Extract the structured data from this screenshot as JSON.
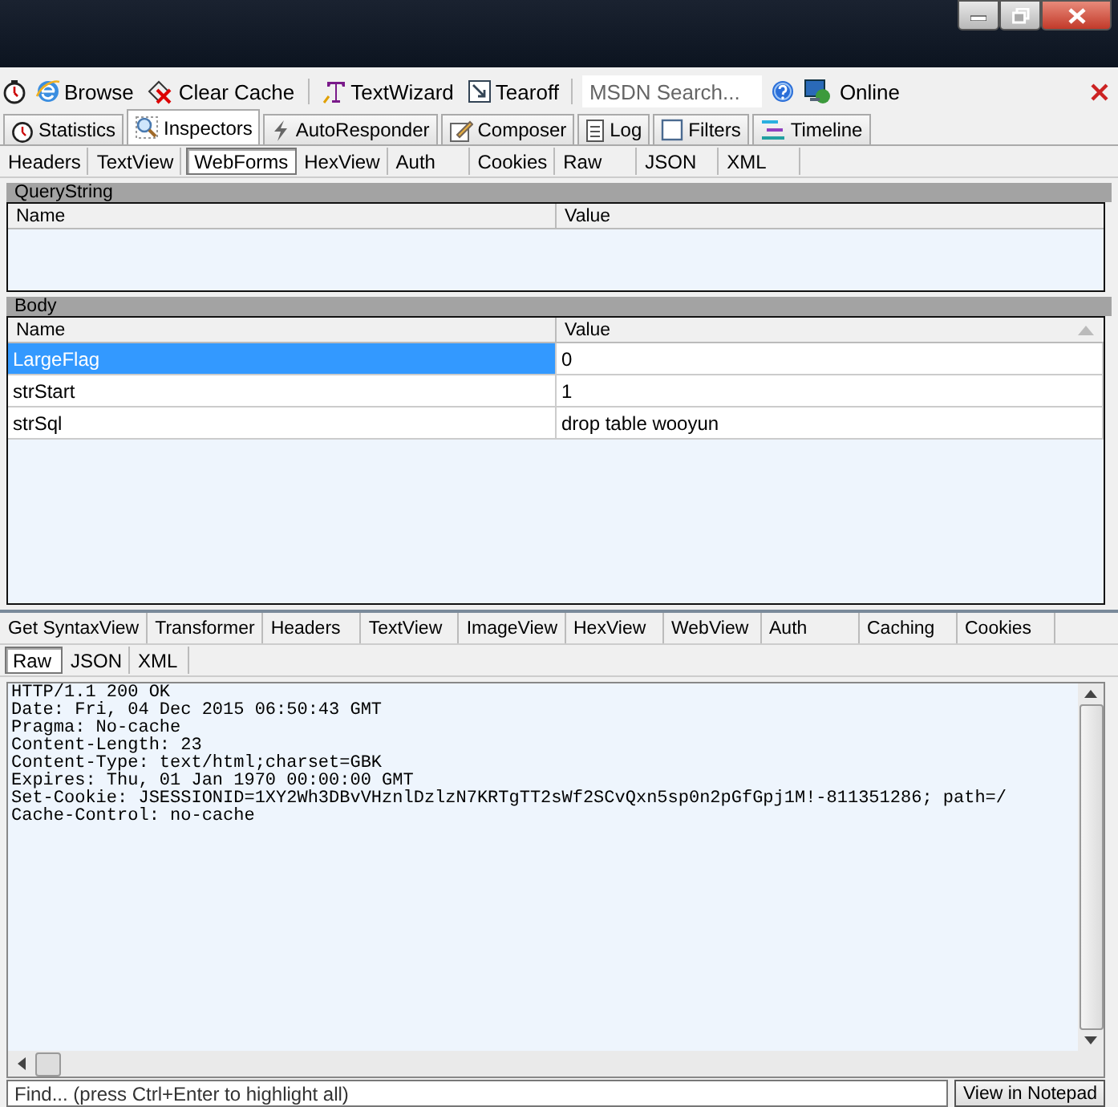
{
  "toolbar": [
    {
      "kind": "button",
      "label": "Browse"
    },
    {
      "kind": "button",
      "label": "Clear Cache"
    },
    {
      "kind": "button",
      "label": "TextWizard"
    },
    {
      "kind": "button",
      "label": "Tearoff"
    },
    {
      "kind": "search",
      "placeholder": "MSDN Search..."
    },
    {
      "kind": "help"
    },
    {
      "kind": "button",
      "label": "Online"
    }
  ],
  "main_tabs": [
    {
      "label": "Statistics",
      "selected": false
    },
    {
      "label": "Inspectors",
      "selected": true
    },
    {
      "label": "AutoResponder",
      "selected": false
    },
    {
      "label": "Composer",
      "selected": false
    },
    {
      "label": "Log",
      "selected": false
    },
    {
      "label": "Filters",
      "selected": false
    },
    {
      "label": "Timeline",
      "selected": false
    }
  ],
  "request_tabs": [
    {
      "label": "Headers",
      "selected": false
    },
    {
      "label": "TextView",
      "selected": false
    },
    {
      "label": "WebForms",
      "selected": true
    },
    {
      "label": "HexView",
      "selected": false
    },
    {
      "label": "Auth",
      "selected": false
    },
    {
      "label": "Cookies",
      "selected": false
    },
    {
      "label": "Raw",
      "selected": false
    },
    {
      "label": "JSON",
      "selected": false
    },
    {
      "label": "XML",
      "selected": false
    }
  ],
  "querystring": {
    "title": "QueryString",
    "columns": [
      "Name",
      "Value"
    ]
  },
  "body": {
    "title": "Body",
    "columns": [
      "Name",
      "Value"
    ],
    "rows": [
      {
        "name": "LargeFlag",
        "value": "0",
        "selected": true
      },
      {
        "name": "strStart",
        "value": "1",
        "selected": false
      },
      {
        "name": "strSql",
        "value": "drop table wooyun",
        "selected": false
      }
    ]
  },
  "response_tabs": [
    {
      "label": "Get SyntaxView",
      "selected": false
    },
    {
      "label": "Transformer",
      "selected": false
    },
    {
      "label": "Headers",
      "selected": false
    },
    {
      "label": "TextView",
      "selected": false
    },
    {
      "label": "ImageView",
      "selected": false
    },
    {
      "label": "HexView",
      "selected": false
    },
    {
      "label": "WebView",
      "selected": false
    },
    {
      "label": "Auth",
      "selected": false
    },
    {
      "label": "Caching",
      "selected": false
    },
    {
      "label": "Cookies",
      "selected": false
    }
  ],
  "response_subtabs": [
    {
      "label": "Raw",
      "selected": true
    },
    {
      "label": "JSON",
      "selected": false
    },
    {
      "label": "XML",
      "selected": false
    }
  ],
  "response_text": "HTTP/1.1 200 OK\nDate: Fri, 04 Dec 2015 06:50:43 GMT\nPragma: No-cache\nContent-Length: 23\nContent-Type: text/html;charset=GBK\nExpires: Thu, 01 Jan 1970 00:00:00 GMT\nSet-Cookie: JSESSIONID=1XY2Wh3DBvVHznlDzlzN7KRTgTT2sWf2SCvQxn5sp0n2pGfGpj1M!-811351286; path=/\nCache-Control: no-cache",
  "find": {
    "placeholder": "Find... (press Ctrl+Enter to highlight all)"
  },
  "notepad_button": "View in Notepad"
}
